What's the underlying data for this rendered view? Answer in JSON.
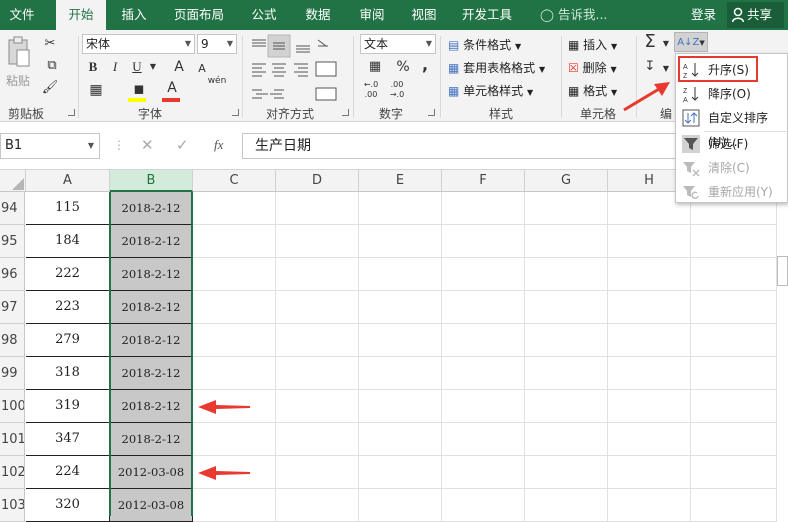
{
  "tabs": [
    {
      "label": "文件",
      "active": false
    },
    {
      "label": "开始",
      "active": true
    },
    {
      "label": "插入",
      "active": false
    },
    {
      "label": "页面布局",
      "active": false
    },
    {
      "label": "公式",
      "active": false
    },
    {
      "label": "数据",
      "active": false
    },
    {
      "label": "审阅",
      "active": false
    },
    {
      "label": "视图",
      "active": false
    },
    {
      "label": "开发工具",
      "active": false
    }
  ],
  "tell_me": "告诉我...",
  "login": "登录",
  "share": "共享",
  "ribbon": {
    "clipboard": {
      "paste": "粘贴",
      "label": "剪贴板"
    },
    "font": {
      "name": "宋体",
      "size": "9",
      "bold": "B",
      "italic": "I",
      "underline": "U",
      "grow": "A",
      "shrink": "A",
      "font_color_letter": "A",
      "phonetic": "wén",
      "label": "字体"
    },
    "alignment": {
      "label": "对齐方式"
    },
    "number": {
      "format": "文本",
      "percent": "%",
      "comma": ",",
      "label": "数字"
    },
    "styles": {
      "conditional": "条件格式",
      "table": "套用表格格式",
      "cell_styles": "单元格样式",
      "label": "样式"
    },
    "cells": {
      "insert": "插入",
      "delete": "删除",
      "format": "格式",
      "label": "单元格"
    },
    "editing": {
      "label": "编"
    }
  },
  "sort_menu": {
    "items": [
      {
        "label": "升序(S)",
        "disabled": false
      },
      {
        "label": "降序(O)",
        "disabled": false
      },
      {
        "label": "自定义排序(U)...",
        "disabled": false
      },
      {
        "label": "筛选(F)",
        "disabled": false
      },
      {
        "label": "清除(C)",
        "disabled": true
      },
      {
        "label": "重新应用(Y)",
        "disabled": true
      }
    ]
  },
  "formula_bar": {
    "name_box": "B1",
    "fx": "fx",
    "content": "生产日期"
  },
  "columns": [
    "A",
    "B",
    "C",
    "D",
    "E",
    "F",
    "G",
    "H"
  ],
  "rows": [
    {
      "num": "94",
      "a": "115",
      "b": "2018-2-12"
    },
    {
      "num": "95",
      "a": "184",
      "b": "2018-2-12"
    },
    {
      "num": "96",
      "a": "222",
      "b": "2018-2-12"
    },
    {
      "num": "97",
      "a": "223",
      "b": "2018-2-12"
    },
    {
      "num": "98",
      "a": "279",
      "b": "2018-2-12"
    },
    {
      "num": "99",
      "a": "318",
      "b": "2018-2-12"
    },
    {
      "num": "100",
      "a": "319",
      "b": "2018-2-12"
    },
    {
      "num": "101",
      "a": "347",
      "b": "2018-2-12"
    },
    {
      "num": "102",
      "a": "224",
      "b": "2012-03-08"
    },
    {
      "num": "103",
      "a": "320",
      "b": "2012-03-08"
    }
  ],
  "colors": {
    "excel_green": "#217346",
    "annotation_red": "#e8392e",
    "selected_fill": "#c8c8c8"
  }
}
